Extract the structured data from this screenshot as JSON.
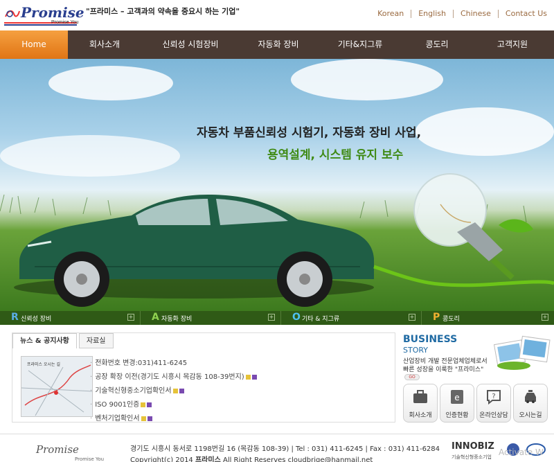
{
  "header": {
    "logo_text": "Promise",
    "logo_sub": "Promise You",
    "slogan": "\"프라미스 – 고객과의 약속을 중요시 하는 기업\"",
    "languages": [
      "Korean",
      "English",
      "Chinese",
      "Contact Us"
    ]
  },
  "nav": {
    "tabs": [
      {
        "label": "Home",
        "active": true
      },
      {
        "label": "회사소개"
      },
      {
        "label": "신뢰성 시험장비"
      },
      {
        "label": "자동화 장비"
      },
      {
        "label": "기타&지그류"
      },
      {
        "label": "콩도리"
      },
      {
        "label": "고객지원"
      }
    ]
  },
  "hero": {
    "line1": "자동차 부품신뢰성 시험기, 자동화 장비 사업,",
    "line2": "용역설계, 시스템 유지 보수"
  },
  "categories": [
    {
      "letter": "R",
      "label": "신뢰성 장비",
      "color": "#5aaee6"
    },
    {
      "letter": "A",
      "label": "자동화 장비",
      "color": "#8fd14f"
    },
    {
      "letter": "O",
      "label": "기타 & 지그류",
      "color": "#4ec0f0"
    },
    {
      "letter": "P",
      "label": "콩도리",
      "color": "#f0b030"
    }
  ],
  "news": {
    "tabs": [
      "뉴스 & 공지사항",
      "자료실"
    ],
    "thumb_caption": "프라미스 오시는 길",
    "items": [
      "전화번호 변경:031)411-6245",
      "공장 확장 이전(경기도 시흥시 목감동 108-39번지)",
      "기술혁신형중소기업확인서",
      "ISO 9001인증",
      "벤처기업확인서"
    ]
  },
  "business": {
    "title": "BUSINESS",
    "subtitle": "STORY",
    "desc1": "산업장비 개발 전문업체업체로서",
    "desc2": "빠른 성장을 이룩한 \"프라미스\"",
    "go": "GO"
  },
  "quick_links": [
    "회사소개",
    "인증현황",
    "온라인상담",
    "오시는길"
  ],
  "footer": {
    "logo_text": "Promise",
    "logo_sub": "Promise You",
    "address": "경기도 시흥시 동서로 1198번길 16 (목감동 108-39)   |   Tel : 031) 411-6245   |   Fax : 031) 411-6284",
    "copyright_prefix": "Copyright(c) 2014",
    "company": "프라미스",
    "copyright_suffix": "All Right Reserves    cloudbrige@hanmail.net",
    "innobiz": "INNOBIZ",
    "innobiz_sub": "기술혁신형중소기업",
    "watermark": "Activate W"
  }
}
